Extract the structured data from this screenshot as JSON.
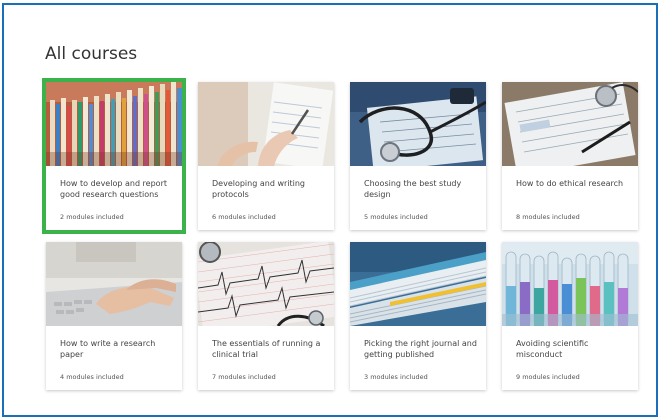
{
  "page": {
    "heading": "All courses"
  },
  "colors": {
    "frame": "#1b6fb8",
    "selected_outline": "#3cb34a"
  },
  "courses": [
    {
      "title": "How to develop and report good research questions",
      "modules": "2 modules included",
      "image": "folders-icon",
      "selected": true
    },
    {
      "title": "Developing and writing protocols",
      "modules": "6 modules included",
      "image": "clipboard-writing-icon",
      "selected": false
    },
    {
      "title": "Choosing the best study design",
      "modules": "5 modules included",
      "image": "stethoscope-icon",
      "selected": false
    },
    {
      "title": "How to do ethical research",
      "modules": "8 modules included",
      "image": "medical-form-icon",
      "selected": false
    },
    {
      "title": "How to write a research paper",
      "modules": "4 modules included",
      "image": "typing-laptop-icon",
      "selected": false
    },
    {
      "title": "The essentials of running a clinical trial",
      "modules": "7 modules included",
      "image": "ecg-chart-icon",
      "selected": false
    },
    {
      "title": "Picking the right journal and getting published",
      "modules": "3 modules included",
      "image": "journal-stack-icon",
      "selected": false
    },
    {
      "title": "Avoiding scientific misconduct",
      "modules": "9 modules included",
      "image": "test-tubes-icon",
      "selected": false
    }
  ]
}
